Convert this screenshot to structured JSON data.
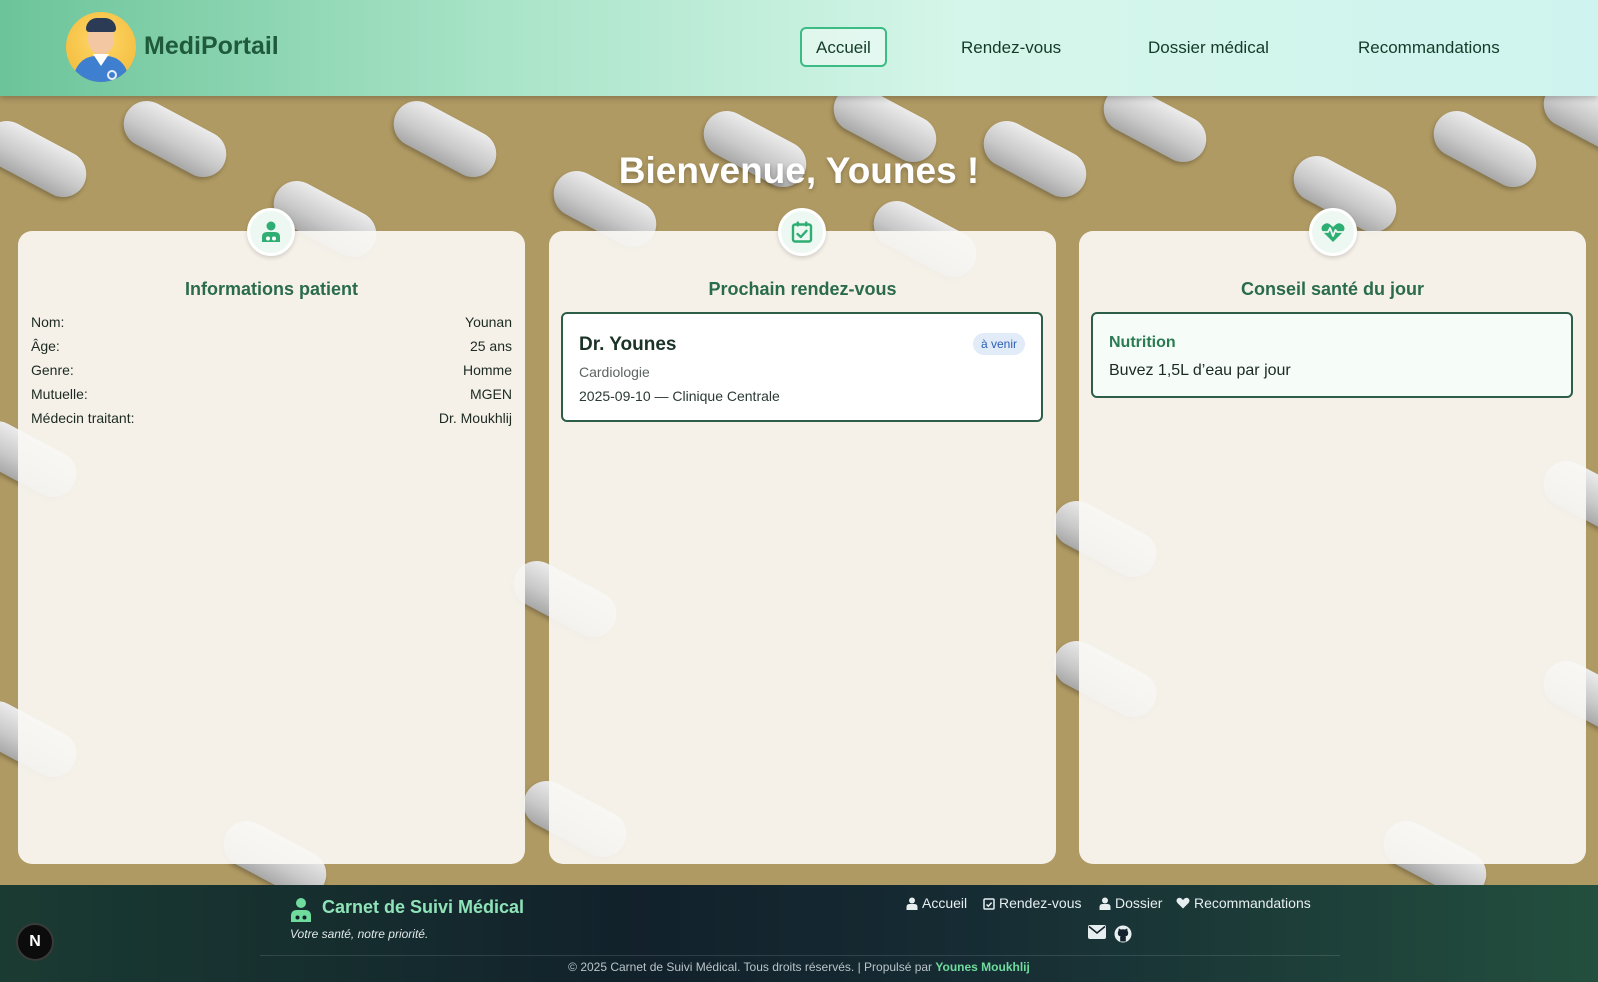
{
  "header": {
    "brand": "MediPortail",
    "nav": [
      "Accueil",
      "Rendez-vous",
      "Dossier médical",
      "Recommandations"
    ],
    "active": "Accueil"
  },
  "welcome": "Bienvenue, Younes !",
  "patient": {
    "title": "Informations patient",
    "rows": [
      {
        "label": "Nom:",
        "value": "Younan"
      },
      {
        "label": "Âge:",
        "value": "25 ans"
      },
      {
        "label": "Genre:",
        "value": "Homme"
      },
      {
        "label": "Mutuelle:",
        "value": "MGEN"
      },
      {
        "label": "Médecin traitant:",
        "value": "Dr. Moukhlij"
      }
    ]
  },
  "appointment": {
    "title": "Prochain rendez-vous",
    "doctor": "Dr. Younes",
    "status": "à venir",
    "specialty": "Cardiologie",
    "details": "2025-09-10 — Clinique Centrale"
  },
  "tip": {
    "title": "Conseil santé du jour",
    "category": "Nutrition",
    "text": "Buvez 1,5L d’eau par jour"
  },
  "footer": {
    "brand": "Carnet de Suivi Médical",
    "tagline": "Votre santé, notre priorité.",
    "links": [
      "Accueil",
      "Rendez-vous",
      "Dossier",
      "Recommandations"
    ],
    "copyright": "© 2025 Carnet de Suivi Médical. Tous droits réservés. | Propulsé par ",
    "author": "Younes Moukhlij"
  },
  "devtools_button": "N",
  "colors": {
    "accent": "#3dbb84",
    "heading_green": "#2a6b4c",
    "footer_dark": "#12212b"
  }
}
